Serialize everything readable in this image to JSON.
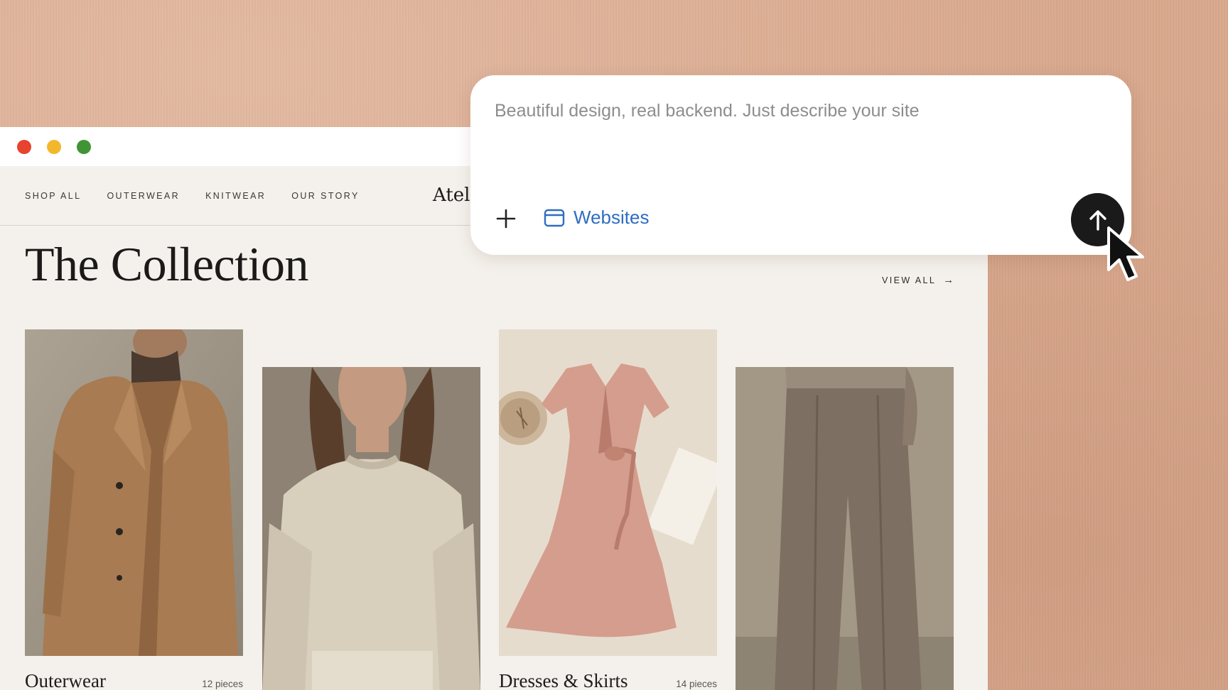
{
  "window": {
    "nav": [
      "SHOP ALL",
      "OUTERWEAR",
      "KNITWEAR",
      "OUR STORY"
    ],
    "brand": "Atel",
    "collection_title": "The Collection",
    "view_all": "VIEW ALL",
    "cards": [
      {
        "name": "Outerwear",
        "count": "12 pieces"
      },
      {
        "name": "",
        "count": ""
      },
      {
        "name": "Dresses & Skirts",
        "count": "14 pieces"
      },
      {
        "name": "",
        "count": ""
      }
    ]
  },
  "prompt": {
    "placeholder": "Beautiful design, real backend. Just describe your site",
    "value": "",
    "mode_label": "Websites"
  },
  "colors": {
    "background": "#d9a88d",
    "page": "#f4f1ec",
    "accent_blue": "#2f6dc2",
    "send_button": "#1a1a1a",
    "traffic_red": "#e8432f",
    "traffic_yellow": "#f3b72c",
    "traffic_green": "#3f9536"
  },
  "icons": {
    "plus": "plus-icon",
    "websites": "browser-window-icon",
    "send": "arrow-up-icon",
    "cursor": "mouse-pointer-icon",
    "view_all": "arrow-right-icon"
  }
}
